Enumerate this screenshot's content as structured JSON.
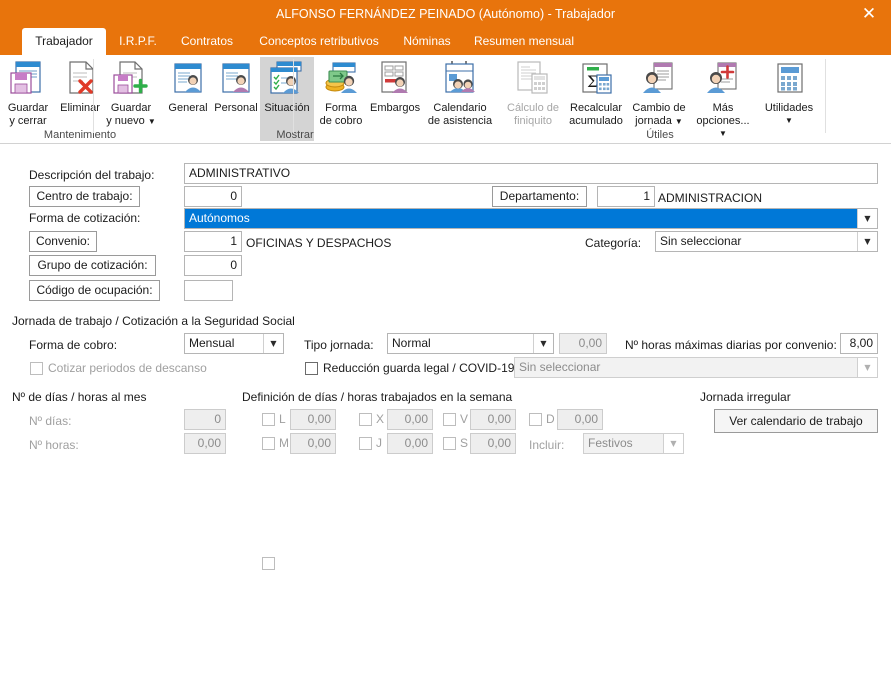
{
  "window": {
    "title": "ALFONSO FERNÁNDEZ PEINADO (Autónomo) - Trabajador",
    "close_icon": "close-icon",
    "accent_color": "#E8740C",
    "selection_color": "#0078D7"
  },
  "tabs": [
    {
      "label": "Trabajador",
      "active": true
    },
    {
      "label": "I.R.P.F.",
      "active": false
    },
    {
      "label": "Contratos",
      "active": false
    },
    {
      "label": "Conceptos retributivos",
      "active": false
    },
    {
      "label": "Nóminas",
      "active": false
    },
    {
      "label": "Resumen mensual",
      "active": false
    }
  ],
  "ribbon": {
    "groups": [
      {
        "label": "Mantenimiento",
        "buttons": [
          {
            "label_line1": "Guardar",
            "label_line2": "y cerrar",
            "icon": "save-close-icon",
            "state": "normal",
            "caret": false
          },
          {
            "label_line1": "Eliminar",
            "label_line2": "",
            "icon": "delete-document-icon",
            "state": "normal",
            "caret": false
          },
          {
            "label_line1": "Guardar",
            "label_line2": "y nuevo",
            "icon": "save-new-icon",
            "state": "normal",
            "caret": true
          }
        ]
      },
      {
        "label": "Mostrar",
        "buttons": [
          {
            "label_line1": "General",
            "label_line2": "",
            "icon": "general-person-icon",
            "state": "normal",
            "caret": false
          },
          {
            "label_line1": "Personal",
            "label_line2": "",
            "icon": "personal-person-icon",
            "state": "normal",
            "caret": false
          },
          {
            "label_line1": "Situación",
            "label_line2": "",
            "icon": "situacion-check-person-icon",
            "state": "selected",
            "caret": false
          },
          {
            "label_line1": "Forma",
            "label_line2": "de cobro",
            "icon": "money-person-icon",
            "state": "normal",
            "caret": false
          },
          {
            "label_line1": "Embargos",
            "label_line2": "",
            "icon": "embargo-document-person-icon",
            "state": "normal",
            "caret": false
          },
          {
            "label_line1": "Calendario",
            "label_line2": "de asistencia",
            "icon": "calendar-people-icon",
            "state": "normal",
            "caret": false
          }
        ]
      },
      {
        "label": "Útiles",
        "buttons": [
          {
            "label_line1": "Cálculo de",
            "label_line2": "finiquito",
            "icon": "calc-document-icon",
            "state": "disabled",
            "caret": false
          },
          {
            "label_line1": "Recalcular",
            "label_line2": "acumulado",
            "icon": "sigma-calculator-icon",
            "state": "normal",
            "caret": false
          },
          {
            "label_line1": "Cambio de",
            "label_line2": "jornada",
            "icon": "person-list-icon",
            "state": "normal",
            "caret": true
          },
          {
            "label_line1": "Más",
            "label_line2": "opciones...",
            "icon": "person-plus-icon",
            "state": "normal",
            "caret": true
          },
          {
            "label_line1": "Utilidades",
            "label_line2": "",
            "icon": "calculator-icon",
            "state": "normal",
            "caret": true
          }
        ]
      }
    ]
  },
  "form": {
    "descripcion_label": "Descripción del trabajo:",
    "descripcion_value": "ADMINISTRATIVO",
    "centro_trabajo_label": "Centro de trabajo:",
    "centro_trabajo_value": "0",
    "departamento_label": "Departamento:",
    "departamento_value": "1",
    "departamento_name": "ADMINISTRACION",
    "forma_cotizacion_label": "Forma de cotización:",
    "forma_cotizacion_value": "Autónomos",
    "convenio_label": "Convenio:",
    "convenio_value": "1",
    "convenio_name": "OFICINAS Y DESPACHOS",
    "categoria_label": "Categoría:",
    "categoria_value": "Sin seleccionar",
    "grupo_cotizacion_label": "Grupo de cotización:",
    "grupo_cotizacion_value": "0",
    "codigo_ocupacion_label": "Código de ocupación:",
    "codigo_ocupacion_value": "",
    "jornada_section_title": "Jornada de trabajo / Cotización a la Seguridad Social",
    "forma_cobro_label": "Forma de cobro:",
    "forma_cobro_value": "Mensual",
    "tipo_jornada_label": "Tipo jornada:",
    "tipo_jornada_value": "Normal",
    "tipo_jornada_num": "0,00",
    "horas_maximas_label": "Nº horas máximas diarias por convenio:",
    "horas_maximas_value": "8,00",
    "cotizar_descanso_label": "Cotizar periodos de descanso",
    "cotizar_descanso_checked": false,
    "reduccion_label": "Reducción guarda legal / COVID-19",
    "reduccion_checked": false,
    "reduccion_combo_value": "Sin seleccionar",
    "dias_horas_mes_title": "Nº de días / horas al mes",
    "n_dias_label": "Nº días:",
    "n_dias_value": "0",
    "n_horas_label": "Nº horas:",
    "n_horas_value": "0,00",
    "definicion_title": "Definición de días / horas trabajados en la semana",
    "weekdays": [
      {
        "code": "L",
        "value": "0,00",
        "checked": false
      },
      {
        "code": "M",
        "value": "0,00",
        "checked": false
      },
      {
        "code": "X",
        "value": "0,00",
        "checked": false
      },
      {
        "code": "J",
        "value": "0,00",
        "checked": false
      },
      {
        "code": "V",
        "value": "0,00",
        "checked": false
      },
      {
        "code": "S",
        "value": "0,00",
        "checked": false
      },
      {
        "code": "D",
        "value": "0,00",
        "checked": false
      }
    ],
    "incluir_label": "Incluir:",
    "incluir_value": "Festivos",
    "jornada_irregular_title": "Jornada irregular",
    "ver_calendario_button": "Ver calendario de trabajo"
  }
}
